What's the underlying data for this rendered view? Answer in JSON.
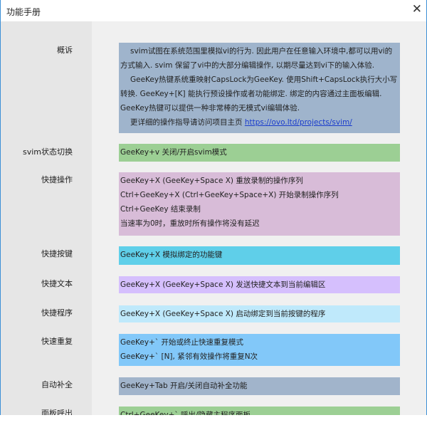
{
  "window": {
    "title": "功能手册",
    "close": "✕"
  },
  "sections": [
    {
      "label": "概诉",
      "color": "#9fb4cc",
      "paragraphs": [
        "svim试图在系统范围里模拟vi的行为. 因此用户在任意输入环境中,都可以用vi的方式输入. svim 保留了vi中的大部分编辑操作, 以期尽量达到vi下的输入体验.",
        "GeeKey热键系统重映射CapsLock为GeeKey. 使用Shift+CapsLock执行大小写转换. GeeKey+[K] 能执行预设操作或者功能绑定. 绑定的内容通过主面板编辑. GeeKey热键可以提供一种非常棒的无模式vi编辑体验."
      ],
      "link_prefix": "更详细的操作指导请访问项目主页 ",
      "link": "https://ovo.ltd/projects/svim/"
    },
    {
      "label": "svim状态切换",
      "color": "#9ccf94",
      "lines": [
        "GeeKey+v 关闭/开启svim模式"
      ]
    },
    {
      "label": "快捷操作",
      "color": "#d8bcd8",
      "lines": [
        "GeeKey+X (GeeKey+Space X) 重放录制的操作序列",
        "Ctrl+GeeKey+X (Ctrl+GeeKey+Space+X) 开始录制操作序列",
        "Ctrl+GeeKey 结束录制",
        "当速率为0时，重放时所有操作将没有延迟"
      ]
    },
    {
      "label": "快捷按键",
      "color": "#5fcfe9",
      "lines": [
        "GeeKey+X 模拟绑定的功能键"
      ]
    },
    {
      "label": "快捷文本",
      "color": "#d5bffd",
      "lines": [
        "GeeKey+X (GeeKey+Space X) 发送快捷文本到当前编辑区"
      ]
    },
    {
      "label": "快捷程序",
      "color": "#bfe9fb",
      "lines": [
        "GeeKey+X (GeeKey+Space X) 启动绑定到当前按键的程序"
      ]
    },
    {
      "label": "快速重复",
      "color": "#82c8f9",
      "lines": [
        "GeeKey+` 开始或终止快速重复模式",
        "GeeKey+` [N], 紧邻有效操作将重复N次"
      ]
    },
    {
      "label": "自动补全",
      "color": "#a1b4cb",
      "lines": [
        "GeeKey+Tab 开启/关闭自动补全功能"
      ]
    },
    {
      "label": "面板呼出",
      "color": "#9ccf94",
      "lines": [
        "Ctrl+GeeKey+` 呼出/隐藏主程序面板"
      ]
    }
  ]
}
